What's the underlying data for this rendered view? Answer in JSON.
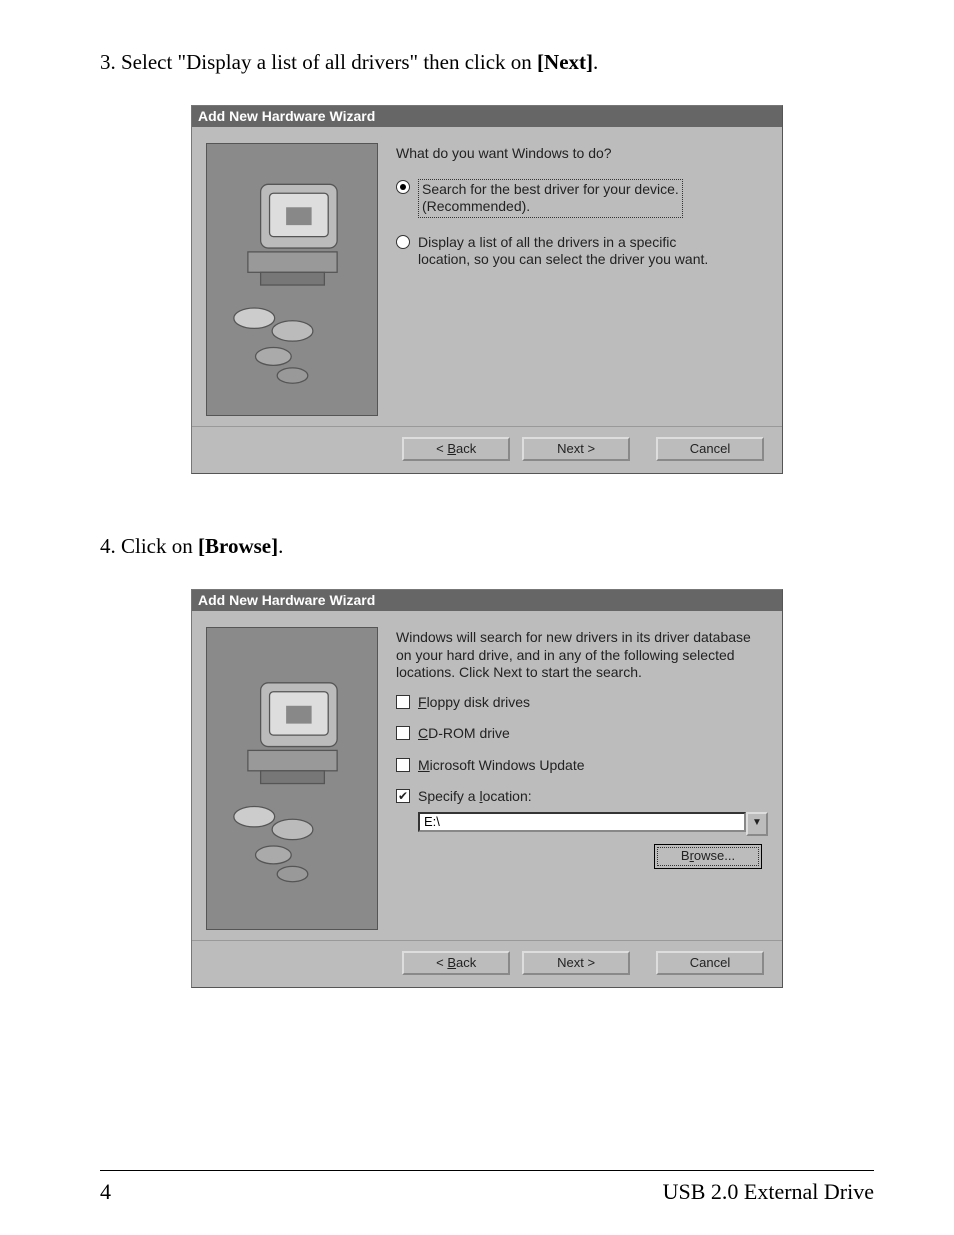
{
  "instructions": {
    "step3_pre": "3. Select \"Display a list of all drivers\" then click on ",
    "step3_bold": "[Next]",
    "step3_post": ".",
    "step4_pre": "4. Click on ",
    "step4_bold": "[Browse]",
    "step4_post": "."
  },
  "dialog1": {
    "title": "Add New Hardware Wizard",
    "prompt": "What do you want Windows to do?",
    "options": [
      {
        "line1": "Search for the best driver for your device.",
        "line2": "(Recommended).",
        "selected": true
      },
      {
        "line1": "Display a list of all the drivers in a specific",
        "line2": "location, so you can select the driver you want.",
        "selected": false
      }
    ],
    "buttons": {
      "back": "< Back",
      "next": "Next >",
      "cancel": "Cancel"
    }
  },
  "dialog2": {
    "title": "Add New Hardware Wizard",
    "prompt": "Windows will search for new drivers in its driver database on your hard drive, and in any of the following selected locations. Click Next to start the search.",
    "checks": [
      {
        "label_pre": "F",
        "label_rest": "loppy disk drives",
        "checked": false
      },
      {
        "label_pre": "C",
        "label_rest": "D-ROM drive",
        "checked": false
      },
      {
        "label_pre": "M",
        "label_rest": "icrosoft Windows Update",
        "checked": false
      },
      {
        "label_pre": "",
        "label_mid": "Specify a ",
        "label_u": "l",
        "label_end": "ocation:",
        "checked": true
      }
    ],
    "location_value": "E:\\",
    "browse_pre": "B",
    "browse_u": "r",
    "browse_rest": "owse...",
    "buttons": {
      "back": "< Back",
      "next": "Next >",
      "cancel": "Cancel"
    }
  },
  "footer": {
    "page": "4",
    "title": "USB 2.0 External Drive"
  }
}
